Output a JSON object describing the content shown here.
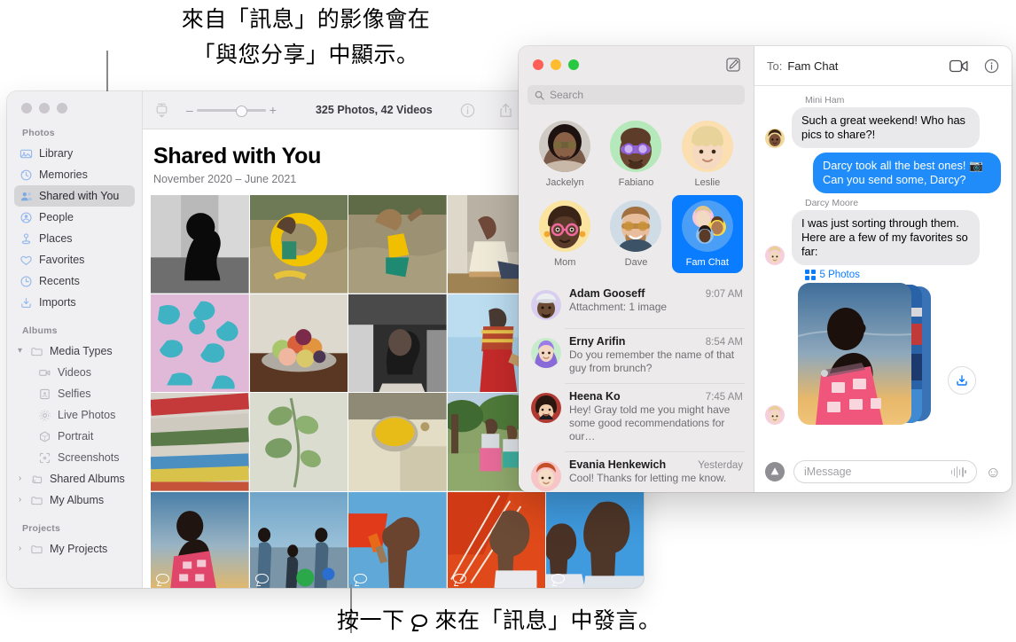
{
  "callouts": {
    "top": "來自「訊息」的影像會在\n「與您分享」中顯示。",
    "bottom_before": "按一下",
    "bottom_after": "來在「訊息」中發言。"
  },
  "photos": {
    "window_title": "Photos",
    "toolbar": {
      "zoom_minus": "–",
      "zoom_plus": "+",
      "count_label": "325 Photos, 42 Videos",
      "icons": [
        "import-icon",
        "info-icon",
        "share-icon",
        "favorite-icon",
        "rotate-icon"
      ]
    },
    "header": {
      "title": "Shared with You",
      "subtitle": "November 2020 – June 2021"
    },
    "sidebar": {
      "sections": [
        {
          "title": "Photos",
          "items": [
            {
              "label": "Library",
              "icon": "library-icon",
              "selected": false
            },
            {
              "label": "Memories",
              "icon": "memories-icon",
              "selected": false
            },
            {
              "label": "Shared with You",
              "icon": "shared-with-you-icon",
              "selected": true
            },
            {
              "label": "People",
              "icon": "people-icon",
              "selected": false
            },
            {
              "label": "Places",
              "icon": "places-icon",
              "selected": false
            },
            {
              "label": "Favorites",
              "icon": "heart-icon",
              "selected": false
            },
            {
              "label": "Recents",
              "icon": "clock-icon",
              "selected": false
            },
            {
              "label": "Imports",
              "icon": "import-icon",
              "selected": false
            }
          ]
        },
        {
          "title": "Albums",
          "items": [
            {
              "label": "Media Types",
              "icon": "folder-icon",
              "selected": false,
              "expanded": true,
              "chevron": "▾"
            },
            {
              "label": "Videos",
              "icon": "video-icon",
              "selected": false,
              "sub": true
            },
            {
              "label": "Selfies",
              "icon": "selfie-icon",
              "selected": false,
              "sub": true
            },
            {
              "label": "Live Photos",
              "icon": "live-photo-icon",
              "selected": false,
              "sub": true
            },
            {
              "label": "Portrait",
              "icon": "portrait-icon",
              "selected": false,
              "sub": true
            },
            {
              "label": "Screenshots",
              "icon": "screenshot-icon",
              "selected": false,
              "sub": true
            },
            {
              "label": "Shared Albums",
              "icon": "shared-album-icon",
              "selected": false,
              "chevron": "›"
            },
            {
              "label": "My Albums",
              "icon": "folder-icon",
              "selected": false,
              "chevron": "›"
            }
          ]
        },
        {
          "title": "Projects",
          "items": [
            {
              "label": "My Projects",
              "icon": "folder-icon",
              "selected": false,
              "chevron": "›"
            }
          ]
        }
      ]
    },
    "grid": [
      {
        "alt": "silhouette-portrait-bw",
        "has_comment": false
      },
      {
        "alt": "child-with-yellow-float-in-river",
        "has_comment": false
      },
      {
        "alt": "child-splashing-in-river",
        "has_comment": false
      },
      {
        "alt": "man-seated-on-floor",
        "has_comment": false
      },
      {
        "alt": "teal-floral-fabric",
        "has_comment": false
      },
      {
        "alt": "pink-blue-floral-pattern",
        "has_comment": false
      },
      {
        "alt": "bowl-of-fruit-on-table",
        "has_comment": false
      },
      {
        "alt": "portrait-curly-hair-bw",
        "has_comment": false
      },
      {
        "alt": "woman-striped-top-red-pants",
        "has_comment": false
      },
      {
        "alt": "red-abstract",
        "has_comment": false
      },
      {
        "alt": "stacked-painted-pipes",
        "has_comment": false
      },
      {
        "alt": "green-leaves-through-screen",
        "has_comment": false
      },
      {
        "alt": "yellow-corn-bowl-overhead",
        "has_comment": false
      },
      {
        "alt": "family-by-tree-field",
        "has_comment": false
      },
      {
        "alt": "outdoor-scene",
        "has_comment": false
      },
      {
        "alt": "woman-pink-dress-at-sunset",
        "has_comment": true
      },
      {
        "alt": "family-wading-in-sea",
        "has_comment": true
      },
      {
        "alt": "boy-with-popsicle-orange-umbrella",
        "has_comment": true
      },
      {
        "alt": "man-under-orange-parasol",
        "has_comment": true
      },
      {
        "alt": "boy-and-man-portrait",
        "has_comment": true
      }
    ]
  },
  "messages": {
    "search": {
      "placeholder": "Search",
      "icon": "search-icon"
    },
    "compose_icon": "compose-icon",
    "pinned": [
      {
        "name": "Jackelyn",
        "avatar": "photo-woman-sunglasses",
        "selected": false
      },
      {
        "name": "Fabiano",
        "avatar": "memoji-man-purple-glasses",
        "selected": false
      },
      {
        "name": "Leslie",
        "avatar": "memoji-child-blonde",
        "selected": false
      },
      {
        "name": "Mom",
        "avatar": "memoji-woman-pink-glasses",
        "selected": false
      },
      {
        "name": "Dave",
        "avatar": "photo-man-sunglasses",
        "selected": false
      },
      {
        "name": "Fam Chat",
        "avatar": "group-avatar",
        "selected": true
      }
    ],
    "conversations": [
      {
        "name": "Adam Gooseff",
        "time": "9:07 AM",
        "preview": "Attachment: 1 image",
        "avatar": "memoji-man-cap"
      },
      {
        "name": "Erny Arifin",
        "time": "8:54 AM",
        "preview": "Do you remember the name of that guy from brunch?",
        "avatar": "memoji-woman-hijab"
      },
      {
        "name": "Heena Ko",
        "time": "7:45 AM",
        "preview": "Hey! Gray told me you might have some good recommendations for our…",
        "avatar": "photo-woman-smiling"
      },
      {
        "name": "Evania Henkewich",
        "time": "Yesterday",
        "preview": "Cool! Thanks for letting me know.",
        "avatar": "memoji-red-hair"
      }
    ],
    "thread": {
      "to_label": "To:",
      "to_name": "Fam Chat",
      "header_icons": [
        "facetime-icon",
        "info-icon"
      ],
      "items": [
        {
          "type": "incoming",
          "sender": "Mini Ham",
          "text": "Such a great weekend! Who has pics to share?!",
          "avatar": "memoji-mini-ham"
        },
        {
          "type": "outgoing",
          "sender": "",
          "text": "Darcy took all the best ones! 📷 Can you send some, Darcy?"
        },
        {
          "type": "incoming",
          "sender": "Darcy Moore",
          "text": "I was just sorting through them. Here are a few of my favorites so far:",
          "avatar": "memoji-darcy"
        },
        {
          "type": "attachment",
          "link_label": "5 Photos",
          "link_icon": "grid-icon",
          "download_icon": "download-icon",
          "avatar": "memoji-darcy",
          "alt": "woman-pink-dress-at-sunset"
        }
      ]
    },
    "composer": {
      "appstore_icon": "appstore-icon",
      "placeholder": "iMessage",
      "audio_icon": "audio-waveform-icon",
      "emoji_icon": "emoji-icon"
    }
  },
  "colors": {
    "accent_blue": "#0a7cff",
    "bubble_blue": "#1f8cf9",
    "bubble_gray": "#e9e9eb",
    "sidebar_bg": "#f0eff1",
    "messages_sidebar_bg": "#eceaea"
  }
}
